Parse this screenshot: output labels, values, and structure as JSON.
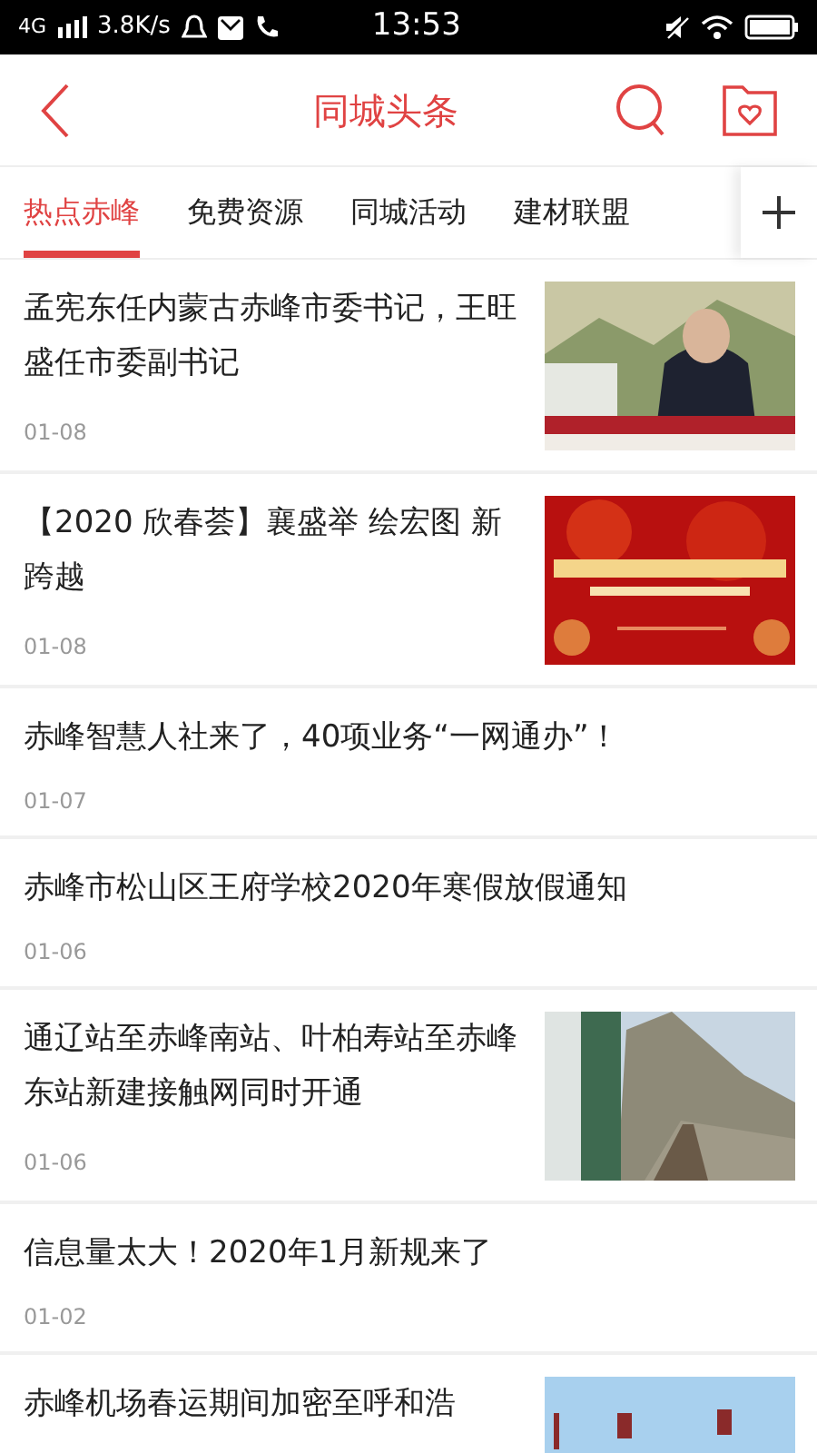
{
  "status_bar": {
    "network": "4G",
    "speed": "3.8K/s",
    "time": "13:53"
  },
  "header": {
    "title": "同城头条"
  },
  "tabs": [
    {
      "label": "热点赤峰",
      "selected": true
    },
    {
      "label": "免费资源",
      "selected": false
    },
    {
      "label": "同城活动",
      "selected": false
    },
    {
      "label": "建材联盟",
      "selected": false
    }
  ],
  "news": [
    {
      "title": "孟宪东任内蒙古赤峰市委书记，王旺盛任市委副书记",
      "date": "01-08"
    },
    {
      "title": "【2020 欣春荟】襄盛举 绘宏图 新跨越",
      "date": "01-08"
    },
    {
      "kind": "text",
      "title": "赤峰智慧人社来了，40项业务“一网通办”！",
      "date": "01-07"
    },
    {
      "kind": "text",
      "title": "赤峰市松山区王府学校2020年寒假放假通知",
      "date": "01-06"
    },
    {
      "title": "通辽站至赤峰南站、叶柏寿站至赤峰东站新建接触网同时开通",
      "date": "01-06"
    },
    {
      "kind": "text",
      "title": "信息量太大！2020年1月新规来了",
      "date": "01-02"
    },
    {
      "title": "赤峰机场春运期间加密至呼和浩"
    }
  ]
}
